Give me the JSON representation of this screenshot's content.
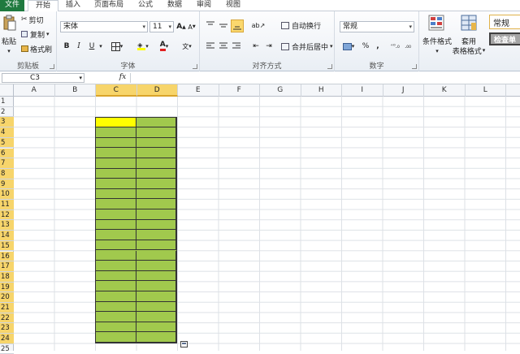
{
  "menu": {
    "tabs": [
      "文件",
      "开始",
      "插入",
      "页面布局",
      "公式",
      "数据",
      "审阅",
      "视图"
    ],
    "active": 1
  },
  "ribbon": {
    "clipboard": {
      "label": "剪贴板",
      "paste": "粘贴",
      "cut": "剪切",
      "copy": "复制",
      "format_painter": "格式刷"
    },
    "font": {
      "label": "字体",
      "name": "宋体",
      "size": "11"
    },
    "align": {
      "label": "对齐方式",
      "wrap": "自动换行",
      "merge": "合并后居中"
    },
    "number": {
      "label": "数字",
      "format": "常规"
    },
    "styles": {
      "conditional": "条件格式",
      "table_format_1": "套用",
      "table_format_2": "表格格式",
      "style_normal": "常规",
      "style_check": "检查单"
    }
  },
  "formula_bar": {
    "name_box": "C3",
    "fx": "fx",
    "value": ""
  },
  "sheet": {
    "columns": [
      "A",
      "B",
      "C",
      "D",
      "E",
      "F",
      "G",
      "H",
      "I",
      "J",
      "K",
      "L"
    ],
    "selected_columns": [
      "C",
      "D"
    ],
    "rows": [
      "1",
      "2",
      "3",
      "4",
      "5",
      "6",
      "7",
      "8",
      "9",
      "10",
      "11",
      "12",
      "13",
      "14",
      "15",
      "16",
      "17",
      "18",
      "19",
      "20",
      "21",
      "22",
      "23",
      "24",
      "25"
    ],
    "selected_rows_from": 3,
    "selected_rows_to": 24,
    "fill_color": "#a1c94d",
    "active_cell_color": "#ffff00"
  }
}
